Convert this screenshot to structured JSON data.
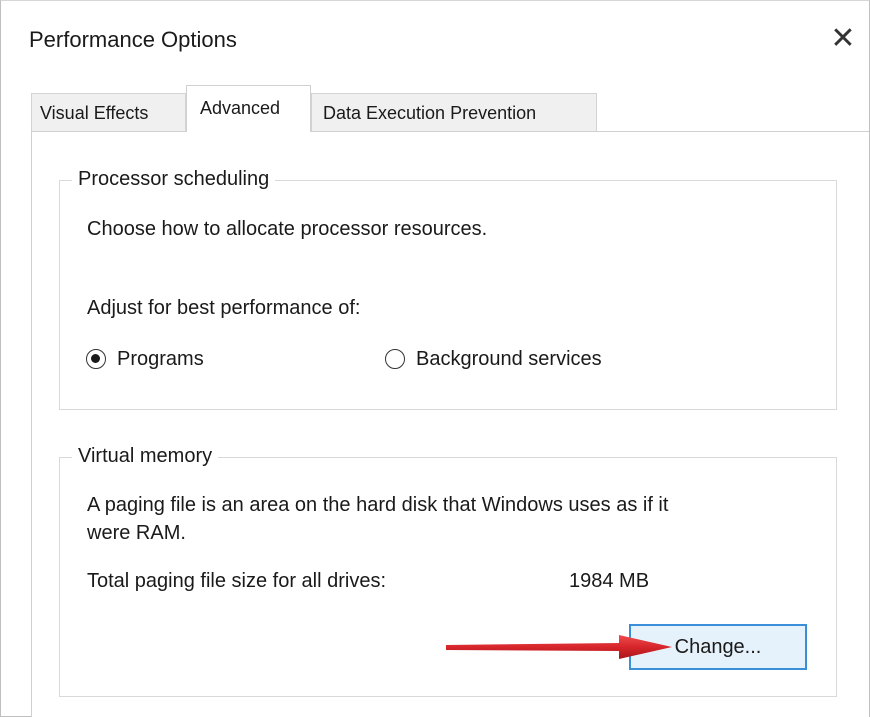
{
  "window": {
    "title": "Performance Options",
    "close_glyph": "✕"
  },
  "tabs": [
    {
      "label": "Visual Effects",
      "selected": false
    },
    {
      "label": "Advanced",
      "selected": true
    },
    {
      "label": "Data Execution Prevention",
      "selected": false
    }
  ],
  "processor_scheduling": {
    "group_label": "Processor scheduling",
    "description": "Choose how to allocate processor resources.",
    "adjust_label": "Adjust for best performance of:",
    "options": [
      {
        "label": "Programs",
        "checked": true
      },
      {
        "label": "Background services",
        "checked": false
      }
    ]
  },
  "virtual_memory": {
    "group_label": "Virtual memory",
    "description_line1": "A paging file is an area on the hard disk that Windows uses as if it",
    "description_line2": "were RAM.",
    "total_label": "Total paging file size for all drives:",
    "total_value": "1984 MB",
    "change_button": "Change..."
  },
  "annotation": {
    "arrow_color": "#d7262b"
  },
  "colors": {
    "button_bg": "#e5f1fb",
    "button_border": "#3a8fd8"
  }
}
